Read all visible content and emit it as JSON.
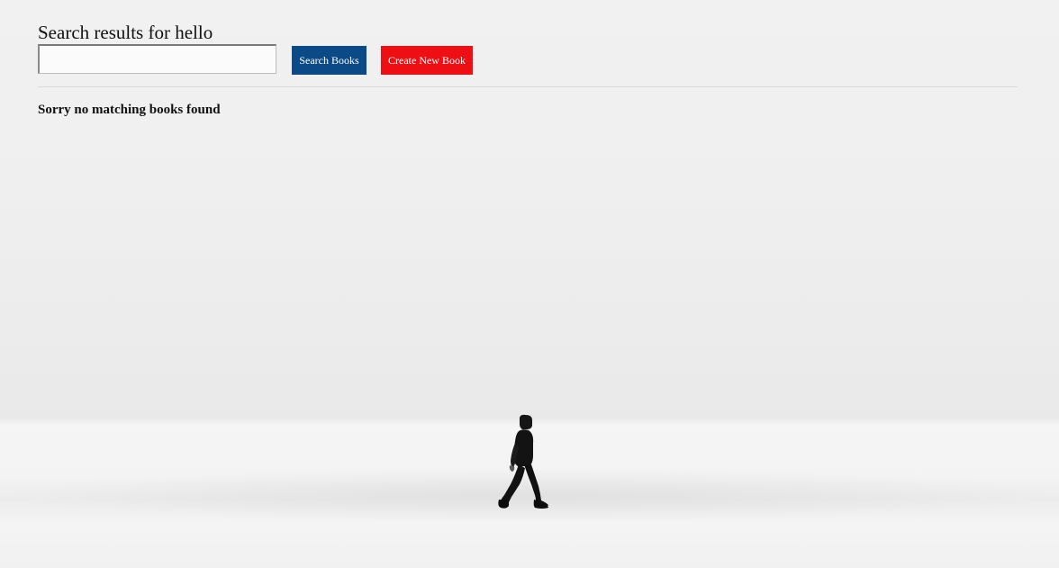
{
  "header": {
    "title": "Search results for hello"
  },
  "search": {
    "value": "",
    "placeholder": ""
  },
  "actions": {
    "search_label": "Search Books",
    "create_label": "Create New Book"
  },
  "results": {
    "empty_message": "Sorry no matching books found"
  },
  "colors": {
    "search_button": "#0b4a86",
    "create_button": "#ee0f14"
  }
}
